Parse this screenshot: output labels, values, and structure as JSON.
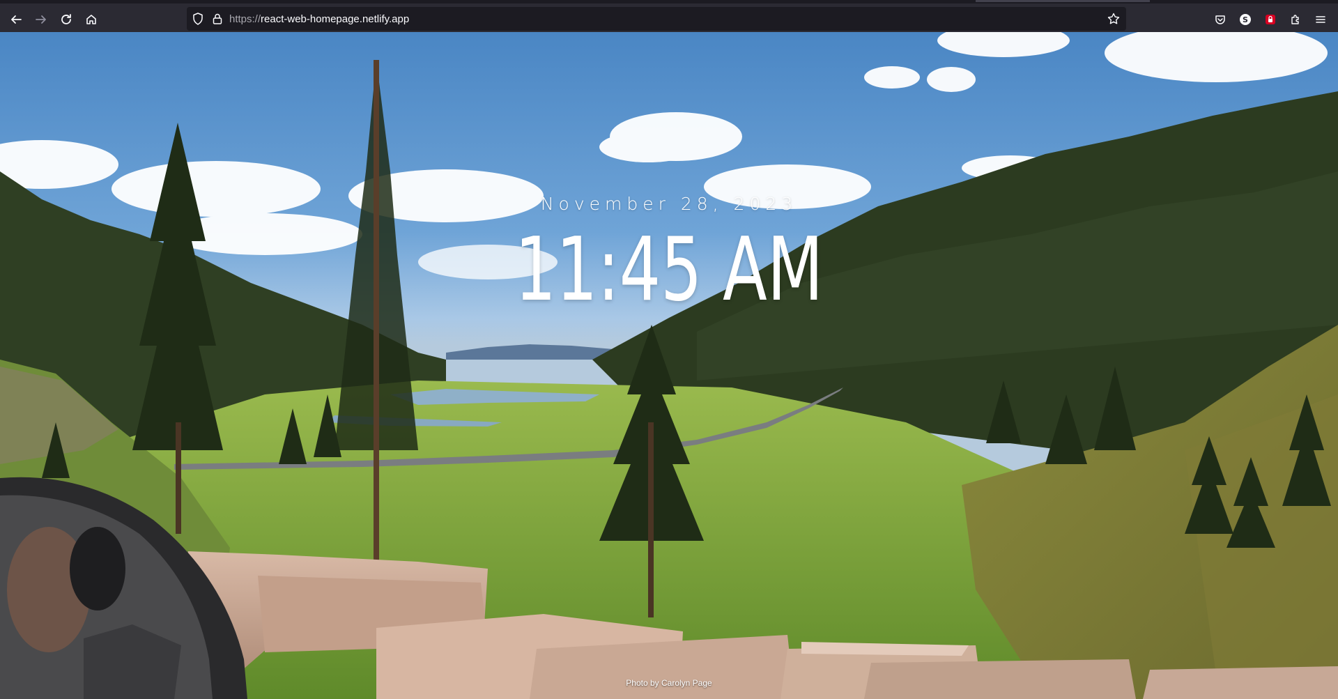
{
  "browser": {
    "url_scheme": "https://",
    "url_host": "react-web-homepage.netlify.app",
    "icons": [
      "back-icon",
      "forward-icon",
      "reload-icon",
      "home-icon",
      "shield-icon",
      "lock-icon",
      "star-icon",
      "pocket-icon",
      "account-icon",
      "extension-badge-icon",
      "extensions-icon",
      "menu-icon"
    ]
  },
  "page": {
    "date": "November 28, 2023",
    "time": "11:45 AM",
    "photo_credit": "Photo by Carolyn Page"
  },
  "colors": {
    "toolbar": "#2b2a33",
    "urlbar": "#1c1b22",
    "text": "#ffffff",
    "sky": "#6fa4d7",
    "forest": "#2e3f22",
    "meadow": "#7ca13a"
  }
}
